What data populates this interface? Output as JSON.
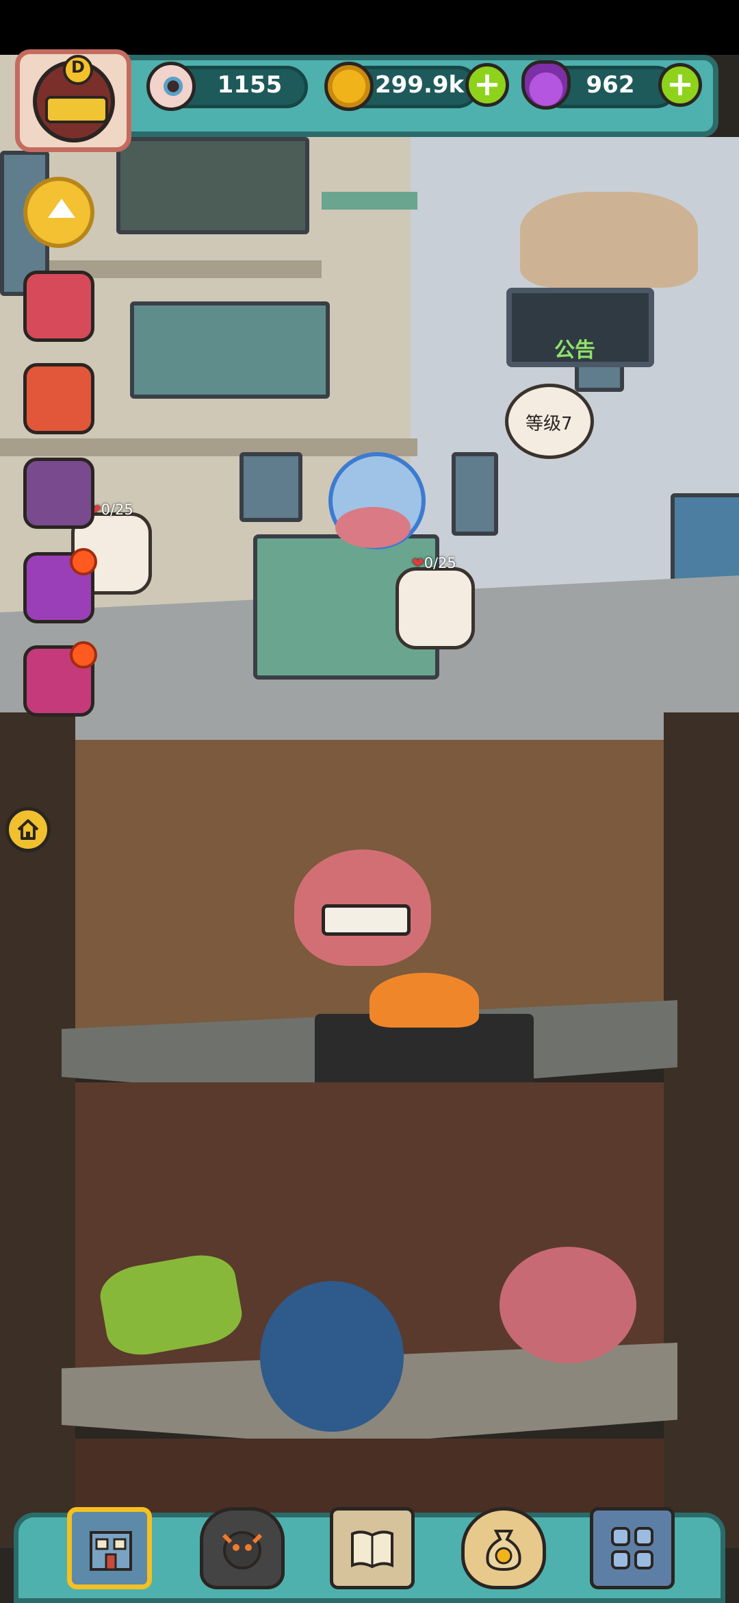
{
  "colors": {
    "hud_teal": "#4fb1ad",
    "hud_dark": "#1f5a5b",
    "plus_green": "#8fd21b",
    "gold": "#f0b319",
    "potion_purple": "#b456e0"
  },
  "player": {
    "rank_letter": "D",
    "avatar_icon": "monster-avatar-icon"
  },
  "resources": {
    "eyeballs": {
      "icon": "eyeball-icon",
      "value": "1155"
    },
    "coins": {
      "icon": "gold-coin-icon",
      "value": "299.9k"
    },
    "potions": {
      "icon": "potion-icon",
      "value": "962"
    }
  },
  "scene": {
    "notice_board": "公告",
    "level_bubble": "等级7",
    "customers": [
      {
        "hunger": "0/25"
      },
      {
        "hunger": "0/25"
      }
    ]
  },
  "left_menu": {
    "collapse_icon": "triangle-up-icon",
    "items": [
      "gift-box-icon",
      "gift-box-icon",
      "card-pack-icon",
      "rainbow-gift-icon",
      "rainbow-gift-icon"
    ],
    "home_icon": "home-icon"
  },
  "bottom_nav": {
    "items": [
      {
        "icon": "building-icon",
        "selected": true
      },
      {
        "icon": "monster-icon",
        "selected": false
      },
      {
        "icon": "book-icon",
        "selected": false
      },
      {
        "icon": "money-bag-icon",
        "selected": false
      },
      {
        "icon": "grid-icon",
        "selected": false
      }
    ]
  }
}
